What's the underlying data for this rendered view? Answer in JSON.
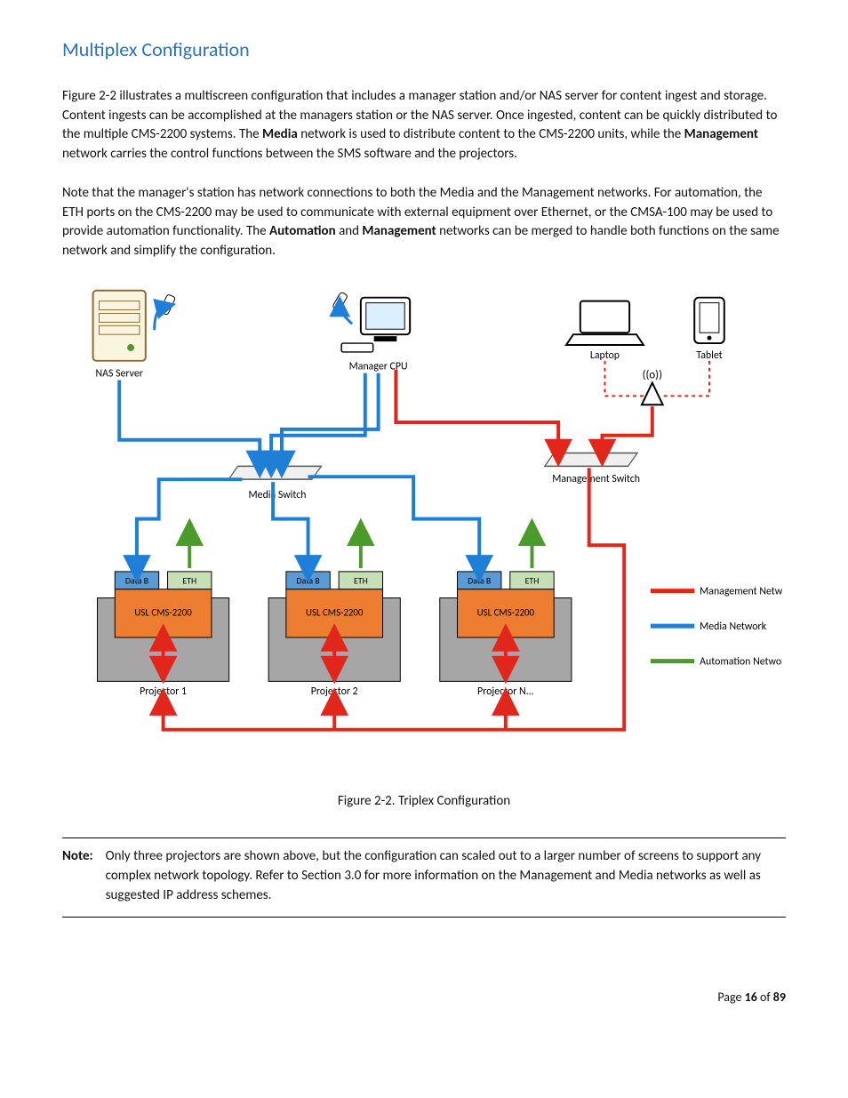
{
  "heading": "Multiplex Configuration",
  "para1_a": "Figure 2-2 illustrates a multiscreen configuration that includes a manager station and/or NAS server for content ingest and storage.  Content ingests can be accomplished at the managers station or the NAS server.  Once ingested, content can be quickly distributed to the multiple CMS-2200 systems.  The ",
  "para1_b1": "Media",
  "para1_c": " network is used to distribute content to the CMS-2200 units, while the ",
  "para1_b2": "Management",
  "para1_d": " network carries the control functions between the SMS software and the projectors.",
  "para2_a": "Note that the manager's station has network connections to both the Media and the Management networks.  For automation, the ETH ports on the CMS-2200 may be used to communicate with external equipment over Ethernet, or the CMSA-100 may be used to provide automation functionality.  The ",
  "para2_b1": "Automation",
  "para2_c": " and ",
  "para2_b2": "Management",
  "para2_d": " networks can be merged to handle both functions on the same network and simplify the configuration.",
  "diagram": {
    "nas": "NAS Server",
    "manager": "Manager CPU",
    "laptop": "Laptop",
    "tablet": "Tablet",
    "media_switch": "Media Switch",
    "mgmt_switch": "Management Switch",
    "port_data": "Data B",
    "port_eth": "ETH",
    "device": "USL CMS-2200",
    "proj1": "Projector 1",
    "proj2": "Projector 2",
    "projN": "Projector N...",
    "legend_mgmt": "Management Network",
    "legend_media": "Media Network",
    "legend_auto": "Automation Network"
  },
  "figure_caption": "Figure 2-2. Triplex Configuration",
  "note_label": "Note:",
  "note_text": "Only three projectors are shown above, but the configuration can scaled out to a larger number of screens to support any complex network topology.  Refer to Section 3.0 for more information on the Management and Media networks as well as suggested IP address schemes.",
  "footer_a": "Page ",
  "footer_b": "16",
  "footer_c": " of ",
  "footer_d": "89"
}
